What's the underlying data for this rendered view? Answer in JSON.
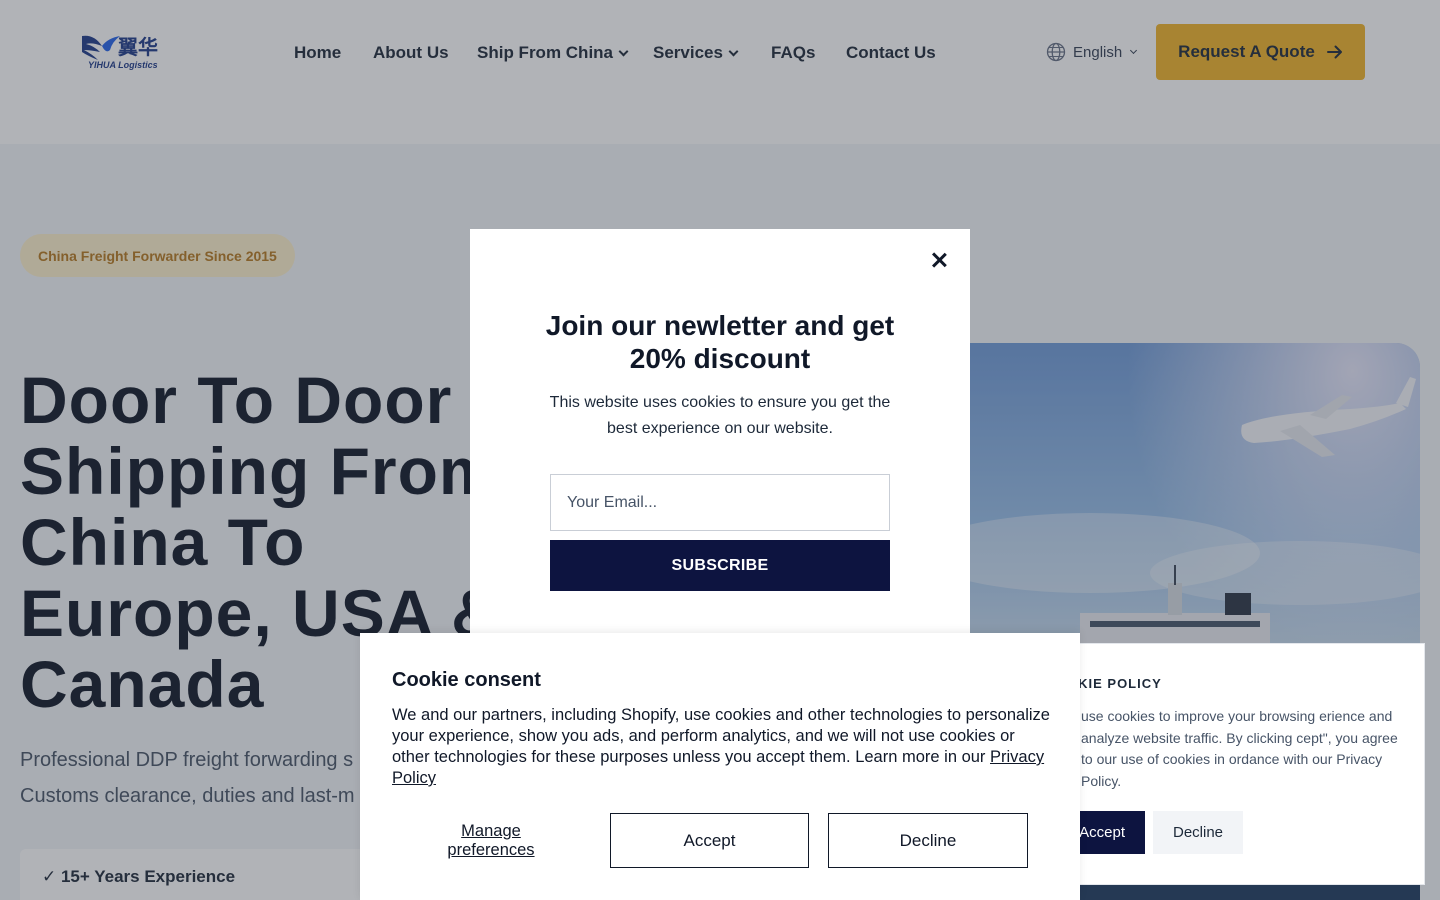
{
  "brand": {
    "logo_cn": "翼华",
    "logo_en": "YIHUA Logistics"
  },
  "nav": {
    "items": [
      {
        "label": "Home"
      },
      {
        "label": "About Us"
      },
      {
        "label": "Ship From China"
      },
      {
        "label": "Services"
      },
      {
        "label": "FAQs"
      },
      {
        "label": "Contact Us"
      }
    ],
    "language": "English",
    "quote_button": "Request A Quote"
  },
  "hero": {
    "badge": "China Freight Forwarder Since 2015",
    "title": "Door To Door Shipping From China To Europe, USA & Canada",
    "subtitle_line1": "Professional DDP freight forwarding s",
    "subtitle_line2": "Customs clearance, duties and last-m",
    "feature": "✓ 15+ Years Experience"
  },
  "newsletter": {
    "title": "Join our newletter and get 20% discount",
    "text": "This website uses cookies to ensure you get the best experience on our website.",
    "email_placeholder": "Your Email...",
    "subscribe": "SUBSCRIBE"
  },
  "cookie_policy": {
    "heading": "OKIE POLICY",
    "text": "use cookies to improve your browsing erience and analyze website traffic. By clicking cept\", you agree to our use of cookies in ordance with our Privacy Policy.",
    "accept": "Accept",
    "decline": "Decline"
  },
  "consent": {
    "title": "Cookie consent",
    "text": "We and our partners, including Shopify, use cookies and other technologies to personalize your experience, show you ads, and perform analytics, and we will not use cookies or other technologies for these purposes unless you accept them. Learn more in our ",
    "privacy_link": "Privacy Policy",
    "manage": "Manage preferences",
    "accept": "Accept",
    "decline": "Decline"
  },
  "colors": {
    "accent": "#f0b429",
    "navy": "#0d1440",
    "heading": "#101828"
  }
}
